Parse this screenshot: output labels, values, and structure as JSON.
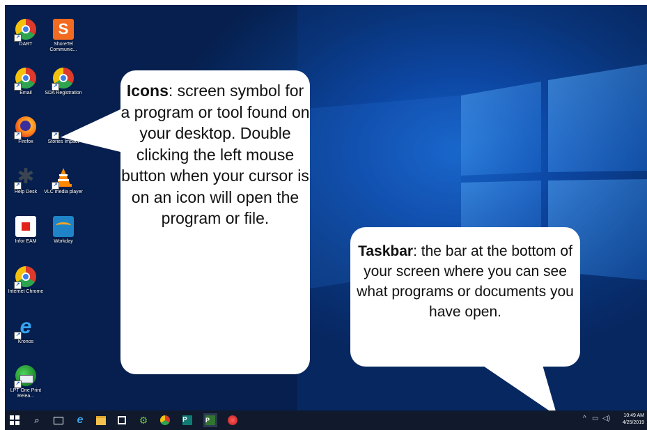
{
  "desktop": {
    "icons": [
      {
        "label": "DART",
        "icon": "chrome-icon"
      },
      {
        "label": "ShoreTel Communic...",
        "icon": "shoretel-icon"
      },
      {
        "label": "Email",
        "icon": "chrome-icon"
      },
      {
        "label": "SDA Registration",
        "icon": "chrome-icon"
      },
      {
        "label": "Firefox",
        "icon": "firefox-icon"
      },
      {
        "label": "Stories Impact",
        "icon": "stories-icon"
      },
      {
        "label": "Help Desk",
        "icon": "helpdesk-icon"
      },
      {
        "label": "VLC media player",
        "icon": "vlc-icon"
      },
      {
        "label": "Infor EAM",
        "icon": "infor-eam-icon"
      },
      {
        "label": "Workday",
        "icon": "workday-icon"
      },
      {
        "label": "Internet Chrome",
        "icon": "chrome-icon"
      },
      {
        "label": "Kronos",
        "icon": "internet-explorer-icon"
      },
      {
        "label": "LPT One Print Relea...",
        "icon": "print-release-icon"
      }
    ]
  },
  "callouts": {
    "icons_term": "Icons",
    "icons_text": ": screen symbol for a program or tool found on your desktop. Double clicking the left mouse button when your cursor is on an icon will open the program or file.",
    "taskbar_term": "Taskbar",
    "taskbar_text": ": the bar at the bottom of your screen where you can see what programs or documents you have open."
  },
  "taskbar": {
    "buttons": [
      "start-icon",
      "search-icon",
      "task-view-icon",
      "edge-icon",
      "file-explorer-icon",
      "store-icon",
      "settings-icon",
      "chrome-icon",
      "publisher-icon",
      "project-icon",
      "snipping-icon"
    ],
    "clock_time": "10:49 AM",
    "clock_date": "4/25/2019"
  },
  "colors": {
    "desktop": "#0d4aa8",
    "taskbar": "#101a2c",
    "bubble": "#ffffff"
  }
}
